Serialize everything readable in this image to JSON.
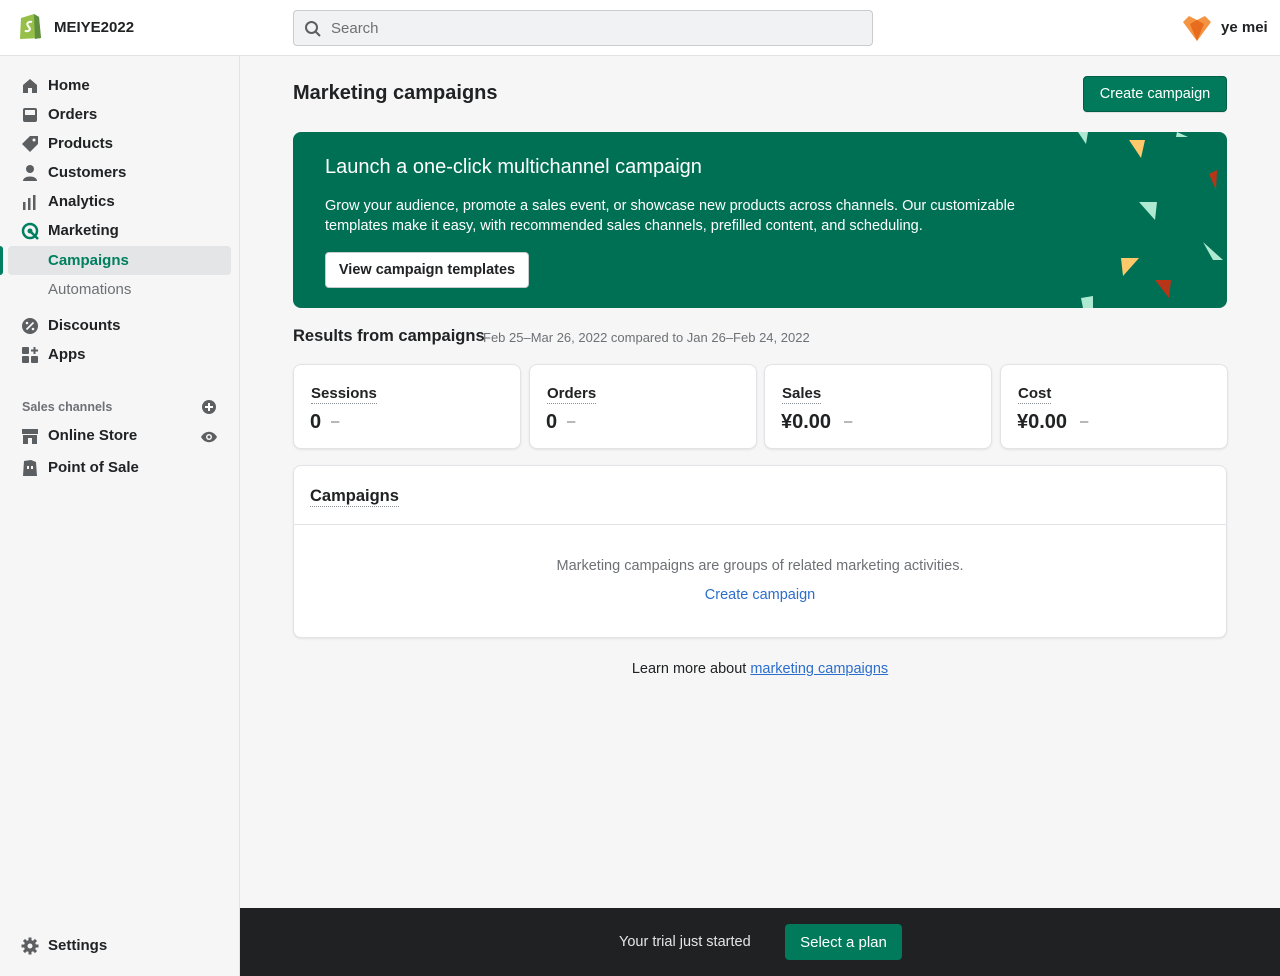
{
  "topbar": {
    "store_name": "MEIYE2022",
    "search_placeholder": "Search",
    "user_name": "ye mei"
  },
  "sidebar": {
    "items": [
      {
        "label": "Home",
        "icon": "home-icon"
      },
      {
        "label": "Orders",
        "icon": "inbox-icon"
      },
      {
        "label": "Products",
        "icon": "tag-icon"
      },
      {
        "label": "Customers",
        "icon": "person-icon"
      },
      {
        "label": "Analytics",
        "icon": "bar-chart-icon"
      },
      {
        "label": "Marketing",
        "icon": "target-icon"
      },
      {
        "label": "Campaigns"
      },
      {
        "label": "Automations"
      },
      {
        "label": "Discounts",
        "icon": "discount-icon"
      },
      {
        "label": "Apps",
        "icon": "apps-icon"
      }
    ],
    "sales_channels_label": "Sales channels",
    "channels": [
      {
        "label": "Online Store",
        "icon": "store-icon"
      },
      {
        "label": "Point of Sale",
        "icon": "pos-icon"
      }
    ],
    "settings_label": "Settings"
  },
  "main": {
    "title": "Marketing campaigns",
    "create_button": "Create campaign",
    "banner": {
      "title": "Launch a one-click multichannel campaign",
      "text": "Grow your audience, promote a sales event, or showcase new products across channels. Our customizable templates make it easy, with recommended sales channels, prefilled content, and scheduling.",
      "button": "View campaign templates"
    },
    "results": {
      "title": "Results from campaigns",
      "range": "Feb 25–Mar 26, 2022 compared to Jan 26–Feb 24, 2022",
      "metrics": [
        {
          "label": "Sessions",
          "value": "0",
          "change": "–"
        },
        {
          "label": "Orders",
          "value": "0",
          "change": "–"
        },
        {
          "label": "Sales",
          "value": "¥0.00",
          "change": "–"
        },
        {
          "label": "Cost",
          "value": "¥0.00",
          "change": "–"
        }
      ]
    },
    "campaigns_card": {
      "title": "Campaigns",
      "empty_text": "Marketing campaigns are groups of related marketing activities.",
      "link": "Create campaign"
    },
    "learn_more": {
      "prefix": "Learn more about ",
      "link": "marketing campaigns"
    }
  },
  "trial_bar": {
    "text": "Your trial just started",
    "button": "Select a plan"
  },
  "colors": {
    "accent": "#008060",
    "banner_bg": "#007054",
    "link": "#2c6ecb"
  }
}
